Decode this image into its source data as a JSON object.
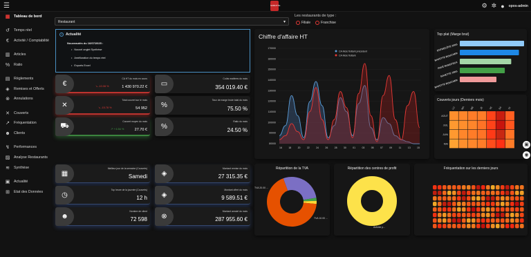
{
  "topbar": {
    "logo_text": "SOBOTTE",
    "user": "opos-admin",
    "icons": [
      "settings-icon",
      "account-cog-icon",
      "user-icon"
    ]
  },
  "sidebar": {
    "items": [
      {
        "label": "Tableau de bord",
        "icon": "dashboard-icon",
        "active": true
      },
      {
        "label": "Temps réel",
        "icon": "history-icon"
      },
      {
        "label": "Activité / Comptabilité",
        "icon": "euro-icon"
      },
      {
        "label": "Articles",
        "icon": "bar-chart-icon"
      },
      {
        "label": "Ratio",
        "icon": "percent-icon"
      },
      {
        "label": "Règlements",
        "icon": "payments-icon"
      },
      {
        "label": "Remises et Offerts",
        "icon": "tag-icon"
      },
      {
        "label": "Annulations",
        "icon": "cancel-icon"
      },
      {
        "label": "Couverts",
        "icon": "cutlery-icon"
      },
      {
        "label": "Fréquentation",
        "icon": "trend-icon"
      },
      {
        "label": "Clients",
        "icon": "people-icon"
      },
      {
        "label": "Performances",
        "icon": "performance-icon"
      },
      {
        "label": "Analyse Restaurants",
        "icon": "analytics-icon"
      },
      {
        "label": "Synthèse",
        "icon": "layers-icon"
      },
      {
        "label": "Actualité",
        "icon": "news-icon"
      },
      {
        "label": "Etat des Données",
        "icon": "add-box-icon"
      }
    ]
  },
  "filters": {
    "restaurant_select": "Restaurant",
    "types_label": "Les restaurants de type :",
    "options": [
      "Filiale",
      "Franchise"
    ]
  },
  "actualite": {
    "title": "Actualité",
    "subtitle": "Nouveautés du 16/07/2025 :",
    "items": [
      "Nouvel onglet Synthèse",
      "Amélioration du temps réel",
      "Exports Excel"
    ]
  },
  "kpis": {
    "ca_ht": {
      "label": "CA HT du mois en cours",
      "value": "1 430 970.22 €",
      "trend": "-10.08 %"
    },
    "total_couvert": {
      "label": "Total couvert sur le mois",
      "value": "54 952",
      "trend": "-15.78 %"
    },
    "couvert_moyen": {
      "label": "Couvert moyen du mois",
      "value": "27.70 €",
      "trend": "+ 6.54 %"
    },
    "couts_matieres": {
      "label": "Coûts matières du mois",
      "value": "354 019.40 €"
    },
    "taux_marge": {
      "label": "Taux de marge brute total du mois",
      "value": "75.50 %"
    },
    "ratio": {
      "label": "Ratio du mois",
      "value": "24.50 %"
    },
    "meilleur_jour": {
      "label": "Meilleur jour de la semaine (Couverts)",
      "value": "Samedi"
    },
    "top_heure": {
      "label": "Top heure de la journée (Couverts)",
      "value": "12 h"
    },
    "nombre_clients": {
      "label": "Nombre de client",
      "value": "72 598"
    },
    "remises": {
      "label": "Montant remise du mois",
      "value": "27 315.35 €"
    },
    "offert": {
      "label": "Montant offert du mois",
      "value": "9 589.51 €"
    },
    "annule": {
      "label": "Montant annulé du mois",
      "value": "287 955.60 €"
    }
  },
  "chart_ca": {
    "title": "Chiffre d'affaire HT",
    "legend": [
      "CA Mois flottant précédent",
      "CA Mois flottant"
    ],
    "ylim": [
      80000,
      175000
    ],
    "y_ticks": [
      "170000",
      "160000",
      "150000",
      "140000",
      "130000",
      "120000",
      "110000",
      "100000",
      "90000",
      "80000"
    ],
    "x_ticks": [
      "16",
      "18",
      "20",
      "22",
      "24",
      "26",
      "28",
      "30",
      "01",
      "03",
      "05",
      "07",
      "09",
      "11",
      "13",
      "15"
    ]
  },
  "top_plat": {
    "title": "Top plat (Marge brut)",
    "items": [
      {
        "label": "ENTRECÔTE 300G",
        "value": 100,
        "color": "#90caf9"
      },
      {
        "label": "BAVETTE BOUCHER",
        "value": 92,
        "color": "#1e88e5"
      },
      {
        "label": "PAVÉ RUMSTECK",
        "value": 80,
        "color": "#a5d6a7"
      },
      {
        "label": "BAVETTE 180G",
        "value": 70,
        "color": "#43a047"
      },
      {
        "label": "BAVETTE BOUCHER",
        "value": 57,
        "color": "#ef9a9a"
      }
    ]
  },
  "couverts_jours": {
    "title": "Couverts jours (Derniers mois)",
    "rows": [
      "AOUT",
      "JUIL",
      "JUIN",
      "MAI"
    ],
    "cols": [
      "LU",
      "MA",
      "ME",
      "JE",
      "VE",
      "SA",
      "DI"
    ],
    "values": [
      [
        0.3,
        0.35,
        0.4,
        0.4,
        0.7,
        0.9,
        0.55
      ],
      [
        0.25,
        0.3,
        0.35,
        0.45,
        0.7,
        0.95,
        0.6
      ],
      [
        0.25,
        0.35,
        0.4,
        0.45,
        0.75,
        0.85,
        0.45
      ],
      [
        0.2,
        0.3,
        0.35,
        0.4,
        0.65,
        0.8,
        0.4
      ]
    ]
  },
  "tva": {
    "title": "Répartition de la TVA",
    "labels": [
      "TVA 20.00 ...",
      "TVA 10.00 ..."
    ],
    "slices": [
      {
        "value": 28,
        "color": "#7b6fc4"
      },
      {
        "value": 2,
        "color": "#43a047"
      },
      {
        "value": 2,
        "color": "#fdd835"
      },
      {
        "value": 68,
        "color": "#e65100"
      }
    ]
  },
  "centres": {
    "title": "Répartition des centres de profit",
    "label": "Activité p...",
    "slices": [
      {
        "value": 100,
        "color": "#fde24a"
      }
    ]
  },
  "frequentation": {
    "title": "Fréquentation sur les derniers jours",
    "rows": 8,
    "cols": 19
  }
}
